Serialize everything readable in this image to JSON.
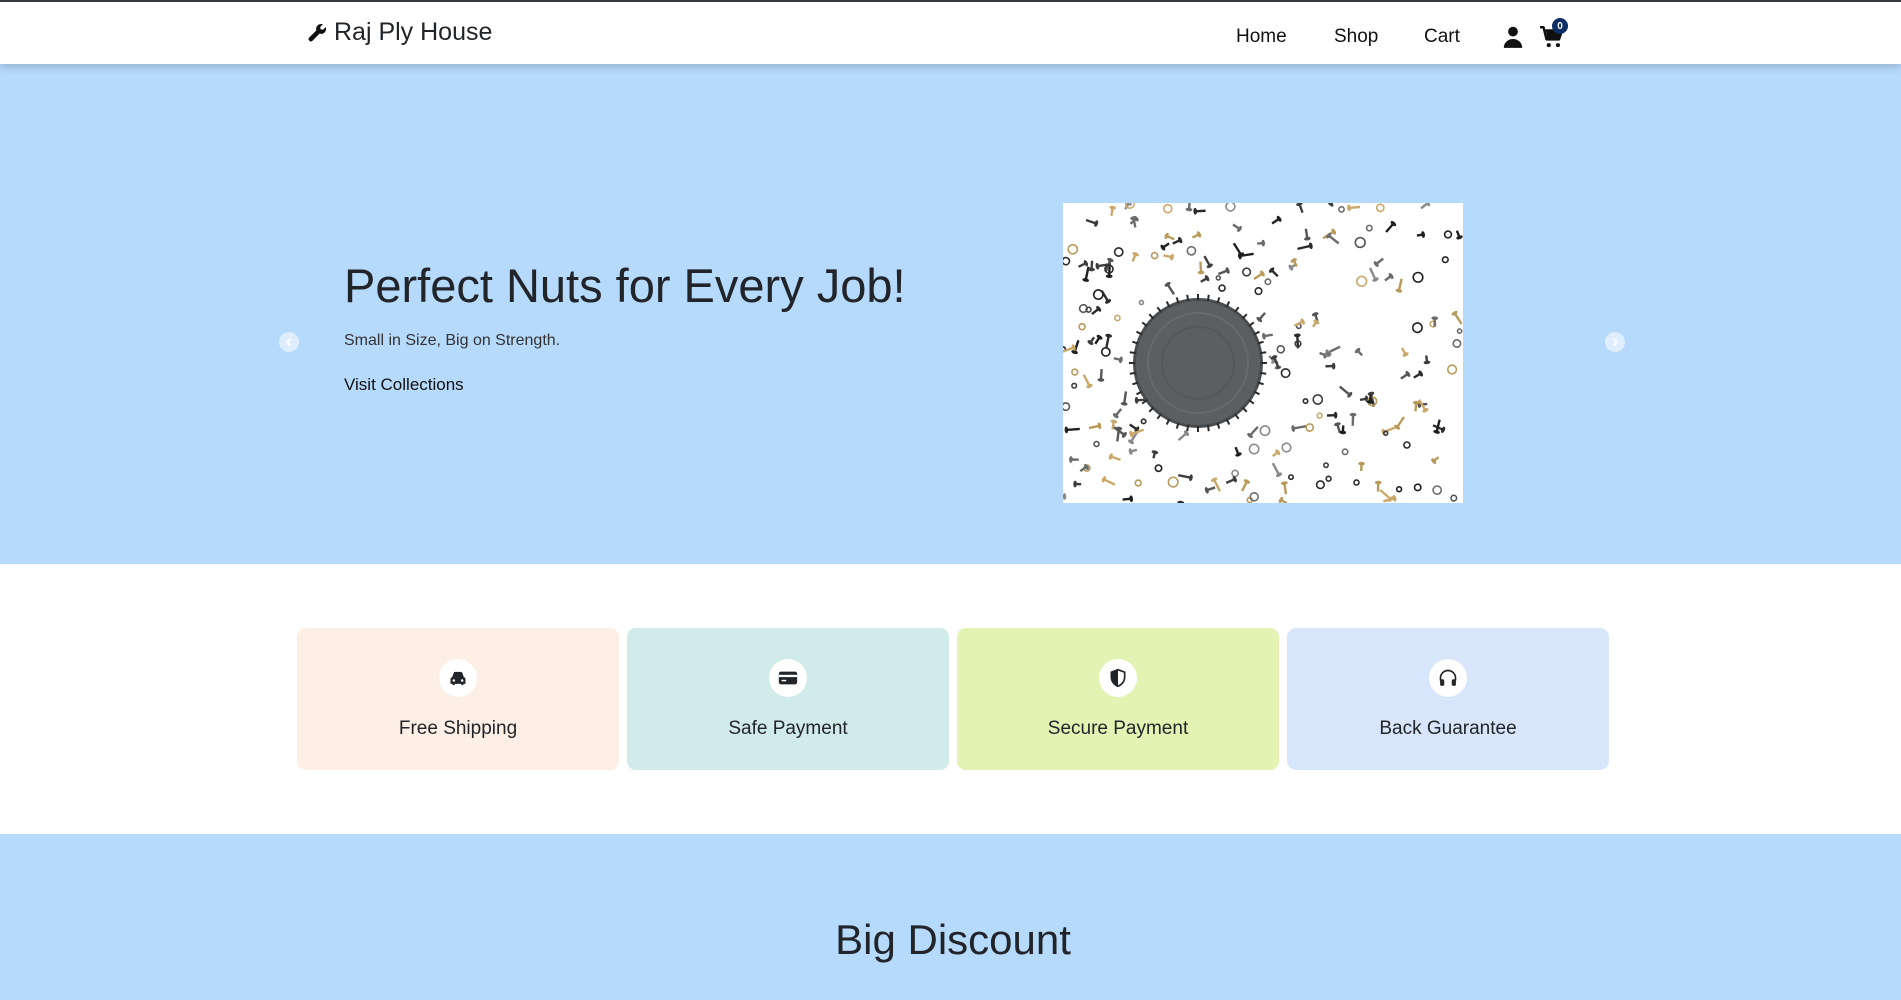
{
  "brand": {
    "name": "Raj Ply House",
    "icon": "wrench-icon"
  },
  "nav": {
    "links": [
      "Home",
      "Shop",
      "Cart"
    ],
    "user_icon": "user-icon",
    "cart_icon": "cart-icon",
    "cart_count": "0"
  },
  "hero": {
    "title": "Perfect Nuts for Every Job!",
    "subtitle": "Small in Size, Big on Strength.",
    "cta": "Visit Collections",
    "image": "screws-and-nuts-image"
  },
  "features": [
    {
      "label": "Free Shipping",
      "icon": "car-icon",
      "color": "#fdeee6"
    },
    {
      "label": "Safe Payment",
      "icon": "credit-card-icon",
      "color": "#d1eaea"
    },
    {
      "label": "Secure Payment",
      "icon": "shield-icon",
      "color": "#e2f3b3"
    },
    {
      "label": "Back Guarantee",
      "icon": "headphones-icon",
      "color": "#d8e6fb"
    }
  ],
  "discount": {
    "title": "Big Discount"
  },
  "colors": {
    "hero_bg": "#b6dafc",
    "cart_badge": "#0d2d66"
  }
}
